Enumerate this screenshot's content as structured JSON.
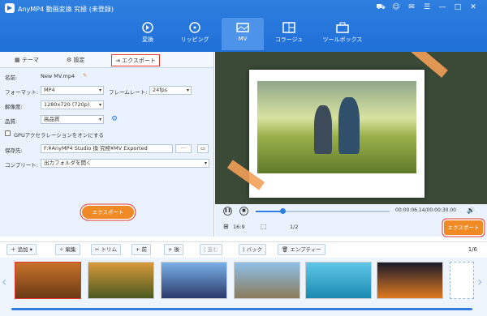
{
  "app": {
    "title": "AnyMP4 動画変換 究極 (未登録)"
  },
  "window_controls": [
    "cart-icon",
    "user-icon",
    "feedback-icon",
    "menu-icon",
    "minimize-icon",
    "maximize-icon",
    "close-icon"
  ],
  "nav": {
    "tabs": [
      {
        "label": "変換",
        "icon": "convert-icon"
      },
      {
        "label": "リッピング",
        "icon": "disc-icon"
      },
      {
        "label": "MV",
        "icon": "mv-icon",
        "active": true
      },
      {
        "label": "コラージュ",
        "icon": "collage-icon"
      },
      {
        "label": "ツールボックス",
        "icon": "toolbox-icon"
      }
    ]
  },
  "panel_tabs": {
    "theme": "テーマ",
    "settings": "設定",
    "export": "エクスポート"
  },
  "form": {
    "name_label": "名前:",
    "name_value": "New MV.mp4",
    "format_label": "フォーマット:",
    "format_value": "MP4",
    "framerate_label": "フレームレート:",
    "framerate_value": "24fps",
    "resolution_label": "解像度:",
    "resolution_value": "1280x720 (720p)",
    "quality_label": "品質:",
    "quality_value": "高品質",
    "gpu_label": "GPUアクセラレーションをオンにする",
    "save_label": "保存先:",
    "save_value": "F:¥AnyMP4 Studio 換 究極¥MV Exported",
    "browse_label": "···",
    "complete_label": "コンプリート:",
    "complete_value": "出力フォルダを開く"
  },
  "export_button": "エクスポート",
  "player": {
    "time": "00:00:06.14/00:00:30.00",
    "aspect": "16:9",
    "scale": "1/2",
    "progress": 0.2
  },
  "toolbar": {
    "add": "追加",
    "edit": "編集",
    "trim": "トリム",
    "prev": "前",
    "next": "後",
    "forward": "進む",
    "back": "バック",
    "empty": "エンプティー",
    "page": "1/6"
  },
  "accent": "#2f7fe0",
  "export_color": "#f08a24",
  "highlight": "#e2372e"
}
